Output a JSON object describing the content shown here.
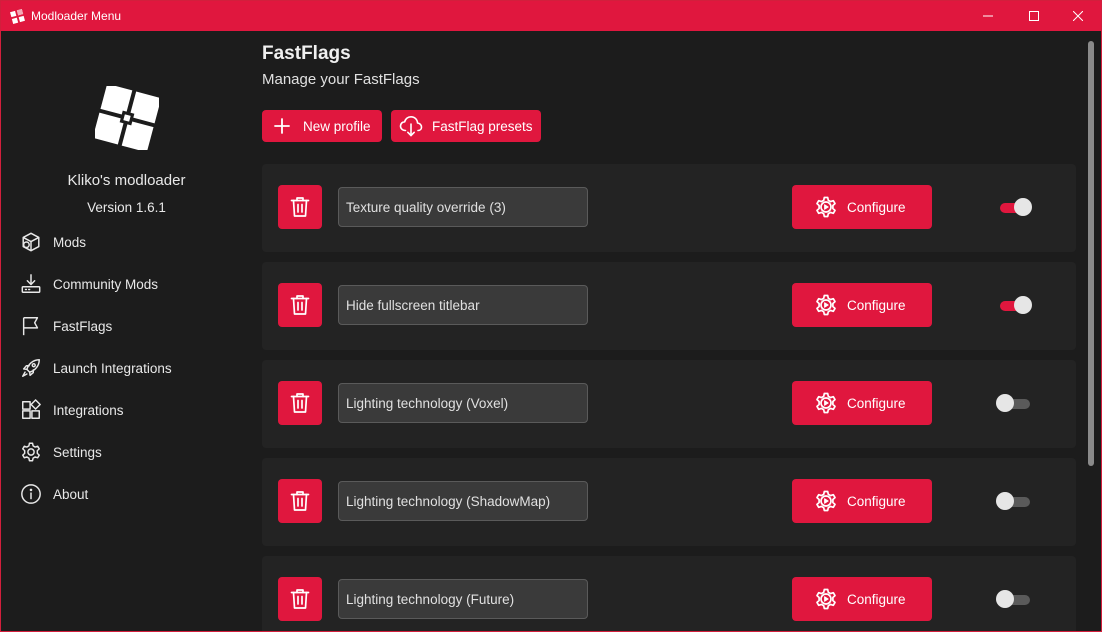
{
  "window": {
    "title": "Modloader Menu",
    "accent": "#e0173e",
    "controls": [
      "minimize-icon",
      "maximize-icon",
      "close-icon"
    ]
  },
  "sidebar": {
    "app_name": "Kliko's modloader",
    "version": "Version 1.6.1",
    "items": [
      {
        "label": "Mods",
        "icon": "cube-icon"
      },
      {
        "label": "Community Mods",
        "icon": "download-icon"
      },
      {
        "label": "FastFlags",
        "icon": "flag-icon"
      },
      {
        "label": "Launch Integrations",
        "icon": "rocket-icon"
      },
      {
        "label": "Integrations",
        "icon": "puzzle-icon"
      },
      {
        "label": "Settings",
        "icon": "gear-icon"
      },
      {
        "label": "About",
        "icon": "info-icon"
      }
    ]
  },
  "main": {
    "title": "FastFlags",
    "subtitle": "Manage your FastFlags",
    "buttons": {
      "new_profile": "New profile",
      "presets": "FastFlag presets"
    },
    "configure_label": "Configure",
    "profiles": [
      {
        "name": "Texture quality override (3)",
        "enabled": true
      },
      {
        "name": "Hide fullscreen titlebar",
        "enabled": true
      },
      {
        "name": "Lighting technology (Voxel)",
        "enabled": false
      },
      {
        "name": "Lighting technology (ShadowMap)",
        "enabled": false
      },
      {
        "name": "Lighting technology (Future)",
        "enabled": false
      }
    ]
  }
}
